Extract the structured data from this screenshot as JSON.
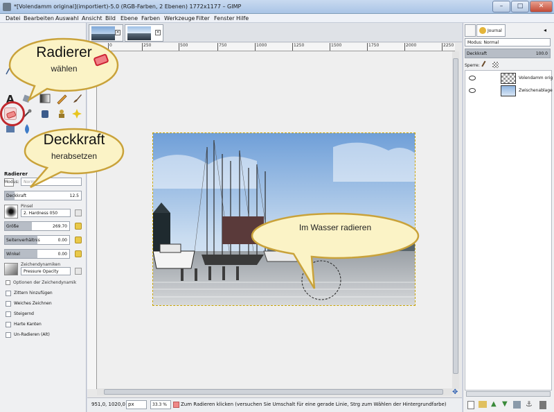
{
  "window": {
    "title": "*[Volendamm original](importiert)-5.0 (RGB-Farben, 2 Ebenen) 1772x1177 – GIMP",
    "buttons": {
      "minimize": "–",
      "maximize": "□",
      "close": "✕"
    }
  },
  "menubar": [
    "Datei",
    "Bearbeiten",
    "Auswahl",
    "Ansicht",
    "Bild",
    "Ebene",
    "Farben",
    "Werkzeuge",
    "Filter",
    "Fenster",
    "Hilfe"
  ],
  "toolbox": {
    "tool_options_title": "Radierer",
    "mode_label": "Modus:",
    "mode_value": "Normal",
    "opacity": {
      "label": "Deckkraft",
      "value": "12.5",
      "fraction": 0.125
    },
    "brush": {
      "label": "Pinsel",
      "value": "2. Hardness 050"
    },
    "size": {
      "label": "Größe",
      "value": "269.70",
      "fraction": 0.42
    },
    "aspect": {
      "label": "Seitenverhältnis",
      "value": "0.00",
      "fraction": 0.5
    },
    "angle": {
      "label": "Winkel",
      "value": "0.00",
      "fraction": 0.5
    },
    "dynamics": {
      "label": "Zeichendynamiken",
      "value": "Pressure Opacity"
    },
    "dynamics_options": "Optionen der Zeichendynamik",
    "checkboxes": [
      "Zittern hinzufügen",
      "Weiches Zeichnen",
      "Steigernd",
      "Harte Kanten",
      "Un-Radieren (Alt)"
    ]
  },
  "canvas": {
    "ruler_marks": [
      "0",
      "250",
      "500",
      "750",
      "1000",
      "1250",
      "1500",
      "1750",
      "2000",
      "2250"
    ],
    "status": {
      "coords": "951,0, 1020,0",
      "unit": "px",
      "zoom": "33.3 %",
      "message": "Zum Radieren klicken (versuchen Sie Umschalt für eine gerade Linie, Strg zum Wählen der Hintergrundfarbe)"
    }
  },
  "dock": {
    "tab_label": "Journal",
    "mode_label": "Modus: Normal",
    "opacity_label": "Deckkraft",
    "opacity_value": "100.0",
    "lock_label": "Sperre:",
    "layers": [
      {
        "name": "Volendamm orig"
      },
      {
        "name": "Zwischenablage"
      }
    ]
  },
  "callouts": {
    "eraser": {
      "title": "Radierer",
      "sub": "wählen"
    },
    "opacity": {
      "title": "Deckkraft",
      "sub": "herabsetzen"
    },
    "water": {
      "title": "Im Wasser radieren"
    }
  },
  "colors": {
    "accent": "#cc2b2b",
    "callout_fill": "#fbf3c6",
    "callout_stroke": "#c9a23a"
  }
}
